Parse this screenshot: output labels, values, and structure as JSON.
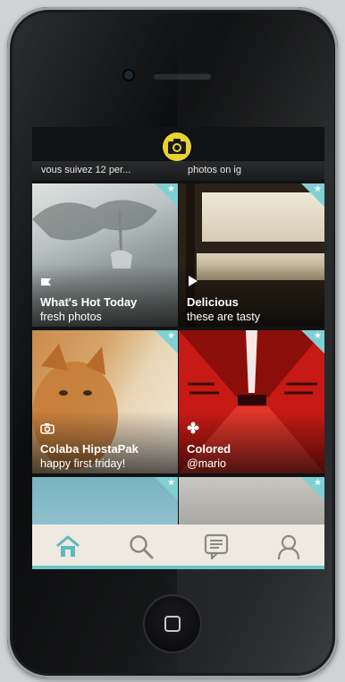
{
  "header": {
    "left_text": "vous suivez 12 per...",
    "right_text": "photos on ig"
  },
  "tiles": [
    {
      "title": "What's Hot Today",
      "subtitle": "fresh photos",
      "icon": "flag-icon"
    },
    {
      "title": "Delicious",
      "subtitle": "these are tasty",
      "icon": "play-icon"
    },
    {
      "title": "Colaba HipstaPak",
      "subtitle": "happy first friday!",
      "icon": "camera-icon"
    },
    {
      "title": "Colored",
      "subtitle": "@mario",
      "icon": "flower-icon"
    }
  ],
  "tabbar": {
    "items": [
      {
        "name": "home",
        "icon": "home-icon",
        "active": true
      },
      {
        "name": "search",
        "icon": "search-icon",
        "active": false
      },
      {
        "name": "comments",
        "icon": "comment-icon",
        "active": false
      },
      {
        "name": "profile",
        "icon": "profile-icon",
        "active": false
      }
    ]
  },
  "colors": {
    "accent": "#6cc3c8",
    "tabbar_bg": "#eeeae2",
    "logo_yellow": "#e8d230"
  }
}
